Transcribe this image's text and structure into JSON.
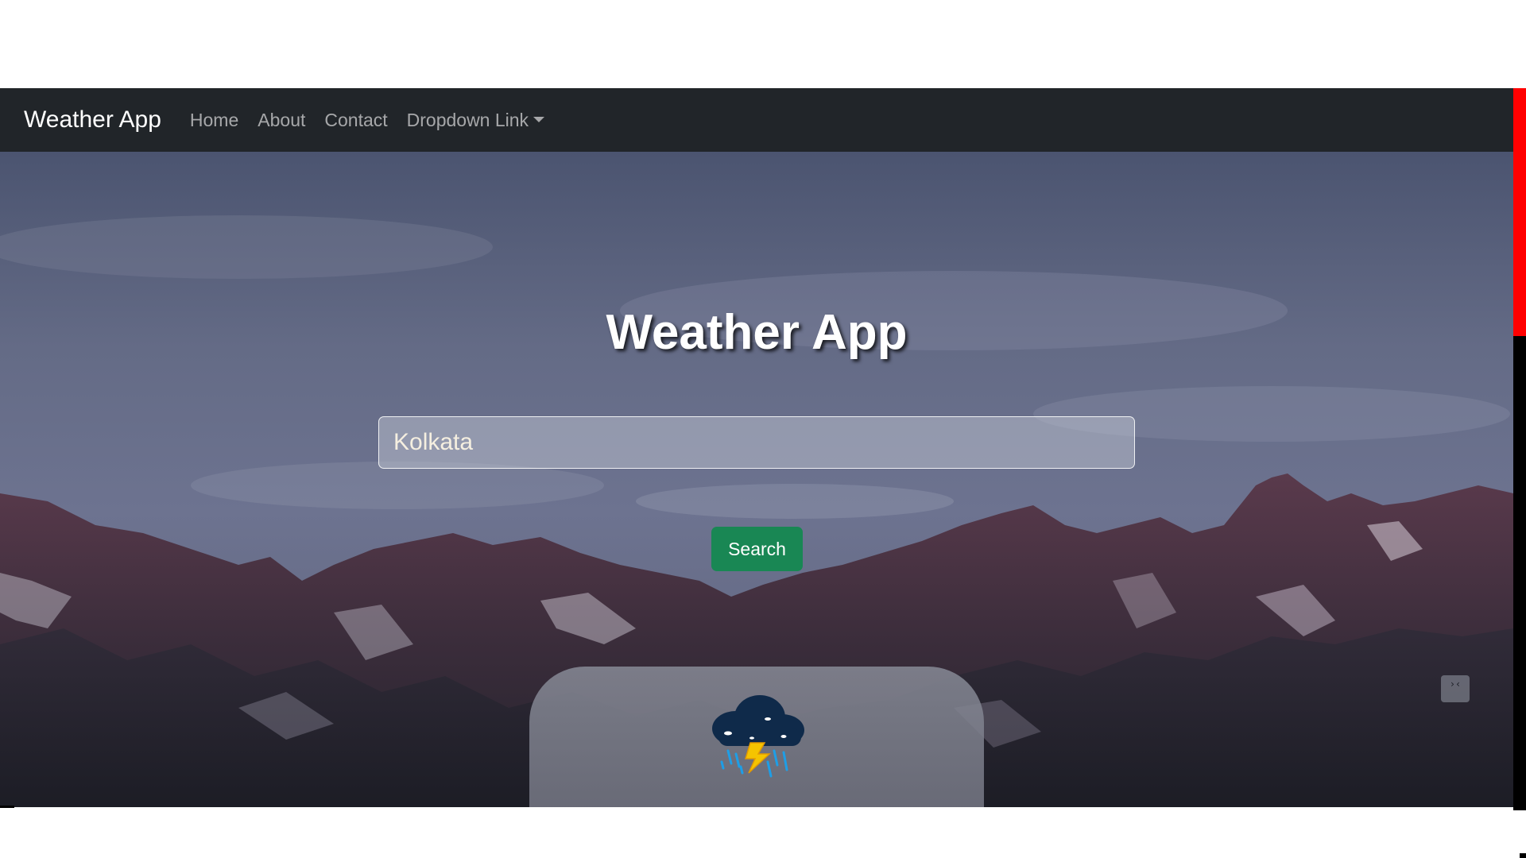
{
  "navbar": {
    "brand": "Weather App",
    "links": [
      "Home",
      "About",
      "Contact"
    ],
    "dropdown_label": "Dropdown Link"
  },
  "hero": {
    "title": "Weather App"
  },
  "search": {
    "value": "Kolkata",
    "button_label": "Search"
  },
  "weather_card": {
    "icon": "thunderstorm-icon"
  },
  "float_widget": {
    "icon": "collapse-icon",
    "glyph": "›‹"
  },
  "colors": {
    "navbar_bg": "#212529",
    "search_button": "#198754",
    "scrollbar_thumb": "#ff0000",
    "scrollbar_track": "#000000"
  }
}
